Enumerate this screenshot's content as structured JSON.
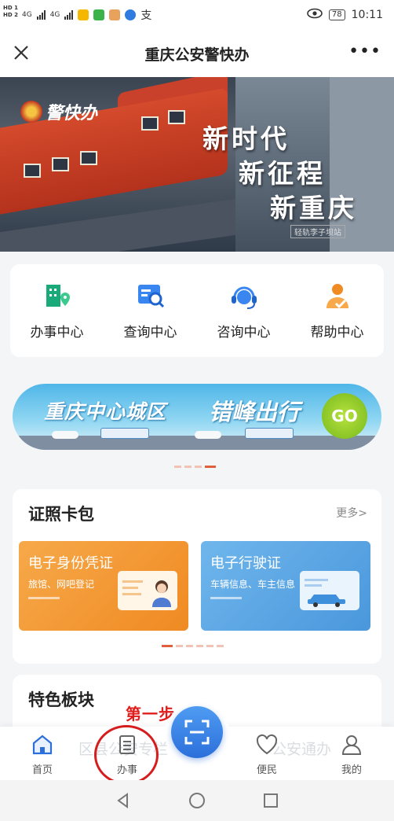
{
  "status_bar": {
    "time": "10:11",
    "battery": "78",
    "network": [
      "4G",
      "4G"
    ],
    "hd": [
      "HD",
      "HD"
    ],
    "sim": [
      "1",
      "2"
    ],
    "notif_text": "支"
  },
  "title_bar": {
    "title": "重庆公安警快办",
    "close_icon": "close-icon",
    "more_label": "•••"
  },
  "banner": {
    "logo_text": "警快办",
    "slogan": [
      "新时代",
      "新征程",
      "新重庆"
    ],
    "caption": "轻轨李子坝站"
  },
  "quick_menu": [
    {
      "label": "办事中心",
      "icon": "building-location-icon",
      "color": "#1aaa7a"
    },
    {
      "label": "查询中心",
      "icon": "search-document-icon",
      "color": "#3a86f0"
    },
    {
      "label": "咨询中心",
      "icon": "headset-icon",
      "color": "#3a86f0"
    },
    {
      "label": "帮助中心",
      "icon": "help-person-icon",
      "color": "#f08a22"
    }
  ],
  "promo": {
    "text_left": "重庆中心城区",
    "text_right": "错峰出行",
    "go_label": "GO"
  },
  "wallet": {
    "title": "证照卡包",
    "more": "更多>",
    "cards": [
      {
        "title": "电子身份凭证",
        "subtitle": "旅馆、网吧登记"
      },
      {
        "title": "电子行驶证",
        "subtitle": "车辆信息、车主信息"
      }
    ]
  },
  "features": {
    "title": "特色板块",
    "faded_left": "区县公安专栏",
    "faded_right": "公安通办"
  },
  "bottom_nav": [
    {
      "label": "首页",
      "icon": "home-icon"
    },
    {
      "label": "办事",
      "icon": "document-icon"
    },
    {
      "label": "便民",
      "icon": "heart-icon"
    },
    {
      "label": "我的",
      "icon": "user-icon"
    }
  ],
  "scan_button": {
    "icon": "scan-icon"
  },
  "annotation": {
    "text": "第一步"
  },
  "colors": {
    "accent_blue": "#2c6fdb",
    "annotation_red": "#e01d1d",
    "id_card": "#f08a22",
    "license_card": "#4a97dc"
  }
}
